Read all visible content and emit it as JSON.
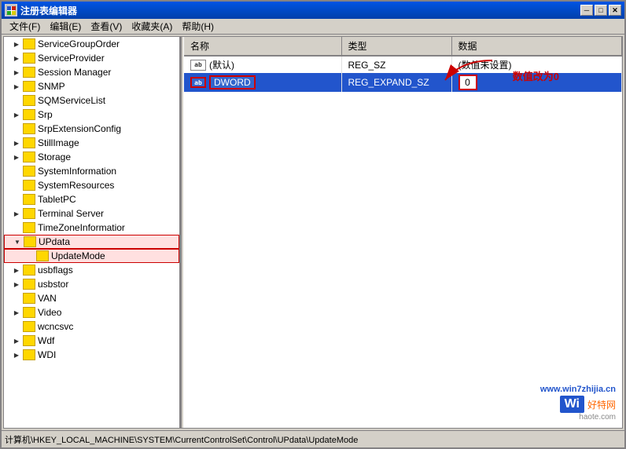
{
  "window": {
    "title": "注册表编辑器",
    "titleIcon": "regedit"
  },
  "titleBarButtons": {
    "minimize": "─",
    "maximize": "□",
    "close": "✕"
  },
  "menuBar": {
    "items": [
      {
        "label": "文件(F)"
      },
      {
        "label": "编辑(E)"
      },
      {
        "label": "查看(V)"
      },
      {
        "label": "收藏夹(A)"
      },
      {
        "label": "帮助(H)"
      }
    ]
  },
  "treeItems": [
    {
      "id": "ServiceGroupOrder",
      "label": "ServiceGroupOrder",
      "indent": 2,
      "hasExpand": true,
      "expandChar": "▶"
    },
    {
      "id": "ServiceProvider",
      "label": "ServiceProvider",
      "indent": 2,
      "hasExpand": true,
      "expandChar": "▶"
    },
    {
      "id": "SessionManager",
      "label": "Session Manager",
      "indent": 2,
      "hasExpand": true,
      "expandChar": "▶"
    },
    {
      "id": "SNMP",
      "label": "SNMP",
      "indent": 2,
      "hasExpand": true,
      "expandChar": "▶"
    },
    {
      "id": "SQMServiceList",
      "label": "SQMServiceList",
      "indent": 2,
      "hasExpand": false
    },
    {
      "id": "Srp",
      "label": "Srp",
      "indent": 2,
      "hasExpand": true,
      "expandChar": "▶"
    },
    {
      "id": "SrpExtensionConfig",
      "label": "SrpExtensionConfig",
      "indent": 2,
      "hasExpand": false
    },
    {
      "id": "StillImage",
      "label": "StillImage",
      "indent": 2,
      "hasExpand": true,
      "expandChar": "▶"
    },
    {
      "id": "Storage",
      "label": "Storage",
      "indent": 2,
      "hasExpand": true,
      "expandChar": "▶"
    },
    {
      "id": "SystemInformation",
      "label": "SystemInformation",
      "indent": 2,
      "hasExpand": false
    },
    {
      "id": "SystemResources",
      "label": "SystemResources",
      "indent": 2,
      "hasExpand": false
    },
    {
      "id": "TabletPC",
      "label": "TabletPC",
      "indent": 2,
      "hasExpand": false
    },
    {
      "id": "TerminalServer",
      "label": "Terminal Server",
      "indent": 2,
      "hasExpand": true,
      "expandChar": "▶"
    },
    {
      "id": "TimeZoneInformation",
      "label": "TimeZoneInformatior",
      "indent": 2,
      "hasExpand": false
    },
    {
      "id": "UPdata",
      "label": "UPdata",
      "indent": 2,
      "hasExpand": true,
      "expandChar": "▼",
      "selected": true,
      "highlighted": true
    },
    {
      "id": "UpdateMode",
      "label": "UpdateMode",
      "indent": 3,
      "hasExpand": false,
      "highlighted": true
    },
    {
      "id": "usbflags",
      "label": "usbflags",
      "indent": 2,
      "hasExpand": true,
      "expandChar": "▶"
    },
    {
      "id": "usbstor",
      "label": "usbstor",
      "indent": 2,
      "hasExpand": true,
      "expandChar": "▶"
    },
    {
      "id": "VAN",
      "label": "VAN",
      "indent": 2,
      "hasExpand": false
    },
    {
      "id": "Video",
      "label": "Video",
      "indent": 2,
      "hasExpand": true,
      "expandChar": "▶"
    },
    {
      "id": "wcncsvc",
      "label": "wcncsvc",
      "indent": 2,
      "hasExpand": false
    },
    {
      "id": "Wdf",
      "label": "Wdf",
      "indent": 2,
      "hasExpand": true,
      "expandChar": "▶"
    },
    {
      "id": "WDI",
      "label": "WDI",
      "indent": 2,
      "hasExpand": true,
      "expandChar": "▶"
    }
  ],
  "tableColumns": [
    {
      "label": "名称"
    },
    {
      "label": "类型"
    },
    {
      "label": "数据"
    }
  ],
  "tableRows": [
    {
      "name": "(默认)",
      "iconType": "ab",
      "iconLabel": "ab",
      "type": "REG_SZ",
      "value": "(数值未设置)"
    },
    {
      "name": "DWORD",
      "iconType": "dword",
      "iconLabel": "ab",
      "type": "REG_EXPAND_SZ",
      "value": "0",
      "highlighted": true
    }
  ],
  "annotation": {
    "text": "数值改为0",
    "arrowColor": "#cc0000"
  },
  "statusBar": {
    "path": "计算机\\HKEY_LOCAL_MACHINE\\SYSTEM\\CurrentControlSet\\Control\\UPdata\\UpdateMode"
  },
  "watermark": {
    "url": "www.win7zhijia.cn",
    "logo": "Wi",
    "site": "好特网",
    "domain": "haote.com"
  }
}
